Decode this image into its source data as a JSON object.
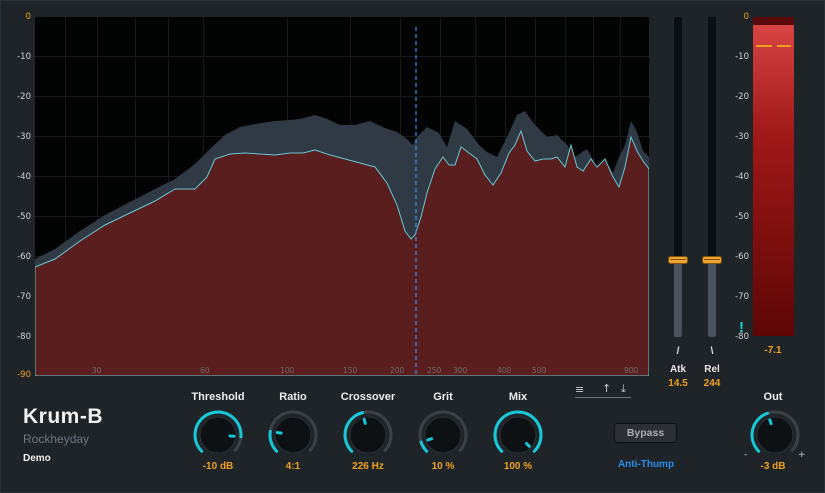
{
  "analyzer": {
    "db_labels": [
      "0",
      "-10",
      "-20",
      "-30",
      "-40",
      "-50",
      "-60",
      "-70",
      "-80",
      "-90"
    ],
    "freq_labels": [
      "30",
      "60",
      "100",
      "150",
      "200",
      "250",
      "300",
      "400",
      "500",
      "900"
    ],
    "crossover_marker_hz": 226,
    "colors": {
      "input_fill": "#2f3a44",
      "output_fill": "#5a1e1e",
      "output_line": "#65c8d6",
      "marker": "#3a8ff0"
    }
  },
  "sliders": {
    "attack": {
      "label": "Atk",
      "value": "14.5",
      "level": 0.24
    },
    "release": {
      "label": "Rel",
      "value": "244",
      "level": 0.24
    }
  },
  "meter": {
    "db_labels": [
      "0",
      "-10",
      "-20",
      "-30",
      "-40",
      "-50",
      "-60",
      "-70",
      "-80"
    ],
    "readout": "-7.1",
    "warning": "!"
  },
  "knobs": [
    {
      "name": "threshold",
      "label": "Threshold",
      "value": "-10 dB",
      "fraction": 0.85
    },
    {
      "name": "ratio",
      "label": "Ratio",
      "value": "4:1",
      "fraction": 0.2
    },
    {
      "name": "crossover",
      "label": "Crossover",
      "value": "226 Hz",
      "fraction": 0.45
    },
    {
      "name": "grit",
      "label": "Grit",
      "value": "10 %",
      "fraction": 0.1
    },
    {
      "name": "mix",
      "label": "Mix",
      "value": "100 %",
      "fraction": 1.0
    }
  ],
  "output": {
    "label": "Out",
    "value": "-3 dB",
    "fraction": 0.43,
    "minus": "-",
    "plus": "+"
  },
  "branding": {
    "product": "Krum-B",
    "company": "Rockheyday",
    "edition": "Demo"
  },
  "buttons": {
    "bypass": "Bypass",
    "anti_thump": "Anti-Thump"
  },
  "icons": [
    "menu-icon",
    "upload-icon",
    "download-icon"
  ],
  "accent_color": "#f0a01e",
  "knob_ring_color": "#17c8d8"
}
